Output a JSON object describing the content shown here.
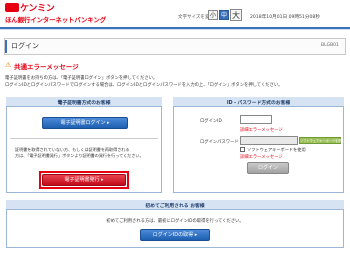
{
  "header": {
    "logo_text": "ケンミン",
    "bank_name": "ほん銀行インターネットバンキング",
    "font_size_label": "文字サイズを変更",
    "font_buttons": [
      "小",
      "中",
      "大"
    ],
    "datetime": "2018年10月01日 09時51分08秒"
  },
  "page": {
    "title": "ログイン",
    "screen_id": "BLGB01"
  },
  "error": {
    "icon": "warning-icon",
    "title": "共通エラーメッセージ"
  },
  "instructions": [
    "電子証明書をお持ちの方は、「電子証明書ログイン」ボタンを押してください。",
    "ログインIDとログインパスワードでログインする場合は、ログインIDとログインパスワードを入力の上、「ログイン」ボタンを押してください。"
  ],
  "cert_panel": {
    "header": "電子証明書方式のお客様",
    "login_button": "電子証明書ログイン",
    "note_lines": [
      "証明書を取得されていない方、もしくは証明書を再取得される",
      "方は、「電子証明書発行」ボタンより証明書の発行を行ってください。"
    ],
    "issue_button": "電子証明書発行"
  },
  "id_panel": {
    "header": "ID・パスワード方式のお客様",
    "login_id_label": "ログインID",
    "login_id_value": "",
    "login_id_error": "詳細エラーメッセージ",
    "password_label": "ログインパスワード",
    "password_value": "",
    "software_keyboard_button": "ソフトウェアキーボードを開く",
    "software_keyboard_checkbox_label": "ソフトウェアキーボードを使用",
    "password_error": "詳細エラーメッセージ",
    "login_button": "ログイン"
  },
  "first_time_panel": {
    "header": "初めてご利用される お客様",
    "description": "初めてご利用される方は、最初にログインIDの取得を行ってください。",
    "obtain_button": "ログインIDの取得"
  },
  "colors": {
    "brand_red": "#e60012",
    "accent_blue": "#3b73b9",
    "panel_header_bg": "#d6e3f3"
  }
}
